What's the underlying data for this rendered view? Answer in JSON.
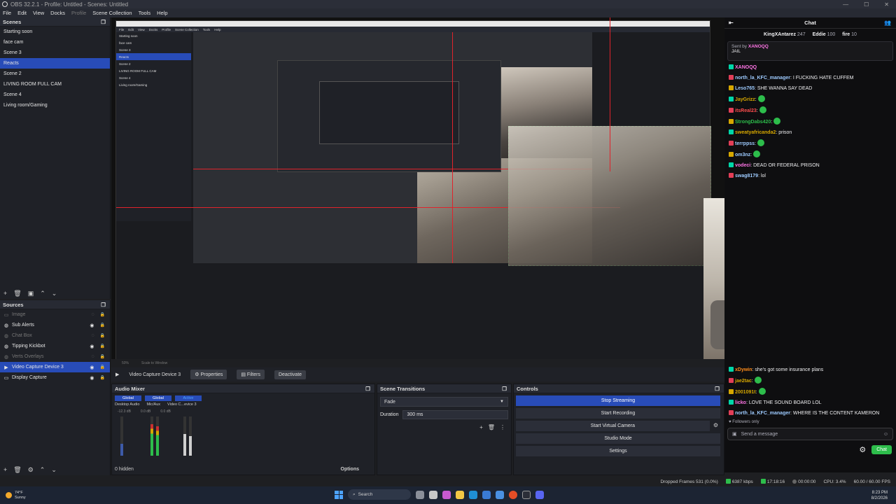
{
  "window": {
    "title": "OBS 32.2.1 - Profile: Untitled - Scenes: Untitled"
  },
  "menu": [
    "File",
    "Edit",
    "View",
    "Docks",
    "Profile",
    "Scene Collection",
    "Tools",
    "Help"
  ],
  "scenes": {
    "heading": "Scenes",
    "items": [
      "Starting soon",
      "face cam",
      "Scene 3",
      "Reacts",
      "Scene 2",
      "LIVING ROOM FULL CAM",
      "Scene 4",
      "Living room/Gaming"
    ],
    "active_index": 3
  },
  "sources": {
    "heading": "Sources",
    "items": [
      {
        "name": "Image",
        "hidden": true
      },
      {
        "name": "Sub Alerts",
        "hidden": false
      },
      {
        "name": "Chat Box",
        "hidden": true
      },
      {
        "name": "Tipping Kickbot",
        "hidden": false
      },
      {
        "name": "Verts Overlays",
        "hidden": true
      },
      {
        "name": "Video Capture Device 3",
        "hidden": false,
        "active": true
      },
      {
        "name": "Display Capture",
        "hidden": false
      }
    ]
  },
  "source_bar": {
    "selected": "Video Capture Device 3",
    "properties": "Properties",
    "filters": "Filters",
    "deactivate": "Deactivate"
  },
  "mixer": {
    "heading": "Audio Mixer",
    "tabs": [
      "Global",
      "Global",
      "Active"
    ],
    "channels": [
      "Desktop Audio",
      "Mic/Aux",
      "Video C...evice 3"
    ],
    "db": [
      "-12.3 dB",
      "0.0 dB",
      "0.0 dB"
    ],
    "hidden_count": "0 hidden",
    "options": "Options"
  },
  "transitions": {
    "heading": "Scene Transitions",
    "selected": "Fade",
    "duration_label": "Duration",
    "duration_value": "300 ms"
  },
  "controls": {
    "heading": "Controls",
    "stop_streaming": "Stop Streaming",
    "start_recording": "Start Recording",
    "start_virtual_camera": "Start Virtual Camera",
    "studio_mode": "Studio Mode",
    "settings": "Settings"
  },
  "status": {
    "dropped_frames": "Dropped Frames 531 (0.0%)",
    "bitrate": "6387 kbps",
    "live_time": "17:18:16",
    "rec_time": "00:00:00",
    "cpu": "CPU: 3.4%",
    "fps": "60.00 / 60.00 FPS"
  },
  "chat": {
    "heading": "Chat",
    "leaders": [
      {
        "name": "KingXAntarez",
        "count": "247"
      },
      {
        "name": "Eddie",
        "count": "100"
      },
      {
        "name": "fire",
        "count": "10"
      }
    ],
    "pinned_by": "Sent by",
    "pinned_user": "XANOQQ",
    "pinned_text": "JAIL",
    "messages_top": [
      {
        "user": "XANOQQ",
        "color": "#ff75e6",
        "text": ""
      },
      {
        "user": "north_la_KFC_manager",
        "color": "#9ecbff",
        "text": ": I FUCKING HATE CUFFEM"
      },
      {
        "user": "Leso765",
        "color": "#9ecbff",
        "text": ": SHE WANNA SAY DEAD"
      },
      {
        "user": "JayGrizz",
        "color": "#d6a700",
        "text": ":"
      },
      {
        "user": "itsReal23",
        "color": "#ff4d4d",
        "text": ":"
      },
      {
        "user": "StrongDabs420",
        "color": "#2dbd4b",
        "text": ":"
      },
      {
        "user": "sweatyafricanda2",
        "color": "#d6a700",
        "text": ": prison"
      },
      {
        "user": "terrppss",
        "color": "#9ecbff",
        "text": ":"
      },
      {
        "user": "om3nz",
        "color": "#9ecbff",
        "text": ":"
      },
      {
        "user": "vodeci",
        "color": "#ff75e6",
        "text": ": DEAD OR FEDERAL PRISON"
      },
      {
        "user": "swag8179",
        "color": "#9ecbff",
        "text": ": lol"
      }
    ],
    "messages_bottom": [
      {
        "user": "xDywin",
        "color": "#ff8c1a",
        "text": ": she's got some insurance plans"
      },
      {
        "user": "jae2tac",
        "color": "#d6a700",
        "text": ":"
      },
      {
        "user": "2001091t",
        "color": "#d6a700",
        "text": ":"
      },
      {
        "user": "licko",
        "color": "#ff75e6",
        "text": ": LOVE THE SOUND BOARD LOL"
      },
      {
        "user": "north_la_KFC_manager",
        "color": "#9ecbff",
        "text": ": WHERE IS THE CONTENT KAMERON"
      }
    ],
    "followers_only": "Followers only",
    "input_placeholder": "Send a message",
    "send_label": "Chat"
  },
  "zoom": {
    "level": "50%",
    "mode": "Scale to Window"
  },
  "taskbar": {
    "weather_temp": "74°F",
    "weather_desc": "Sunny",
    "search_placeholder": "Search",
    "time": "8:23 PM",
    "date": "8/2/2026"
  },
  "colors": {
    "accent": "#284cb8",
    "live_green": "#2dbd4b",
    "chat_bg": "#0e0e10"
  }
}
